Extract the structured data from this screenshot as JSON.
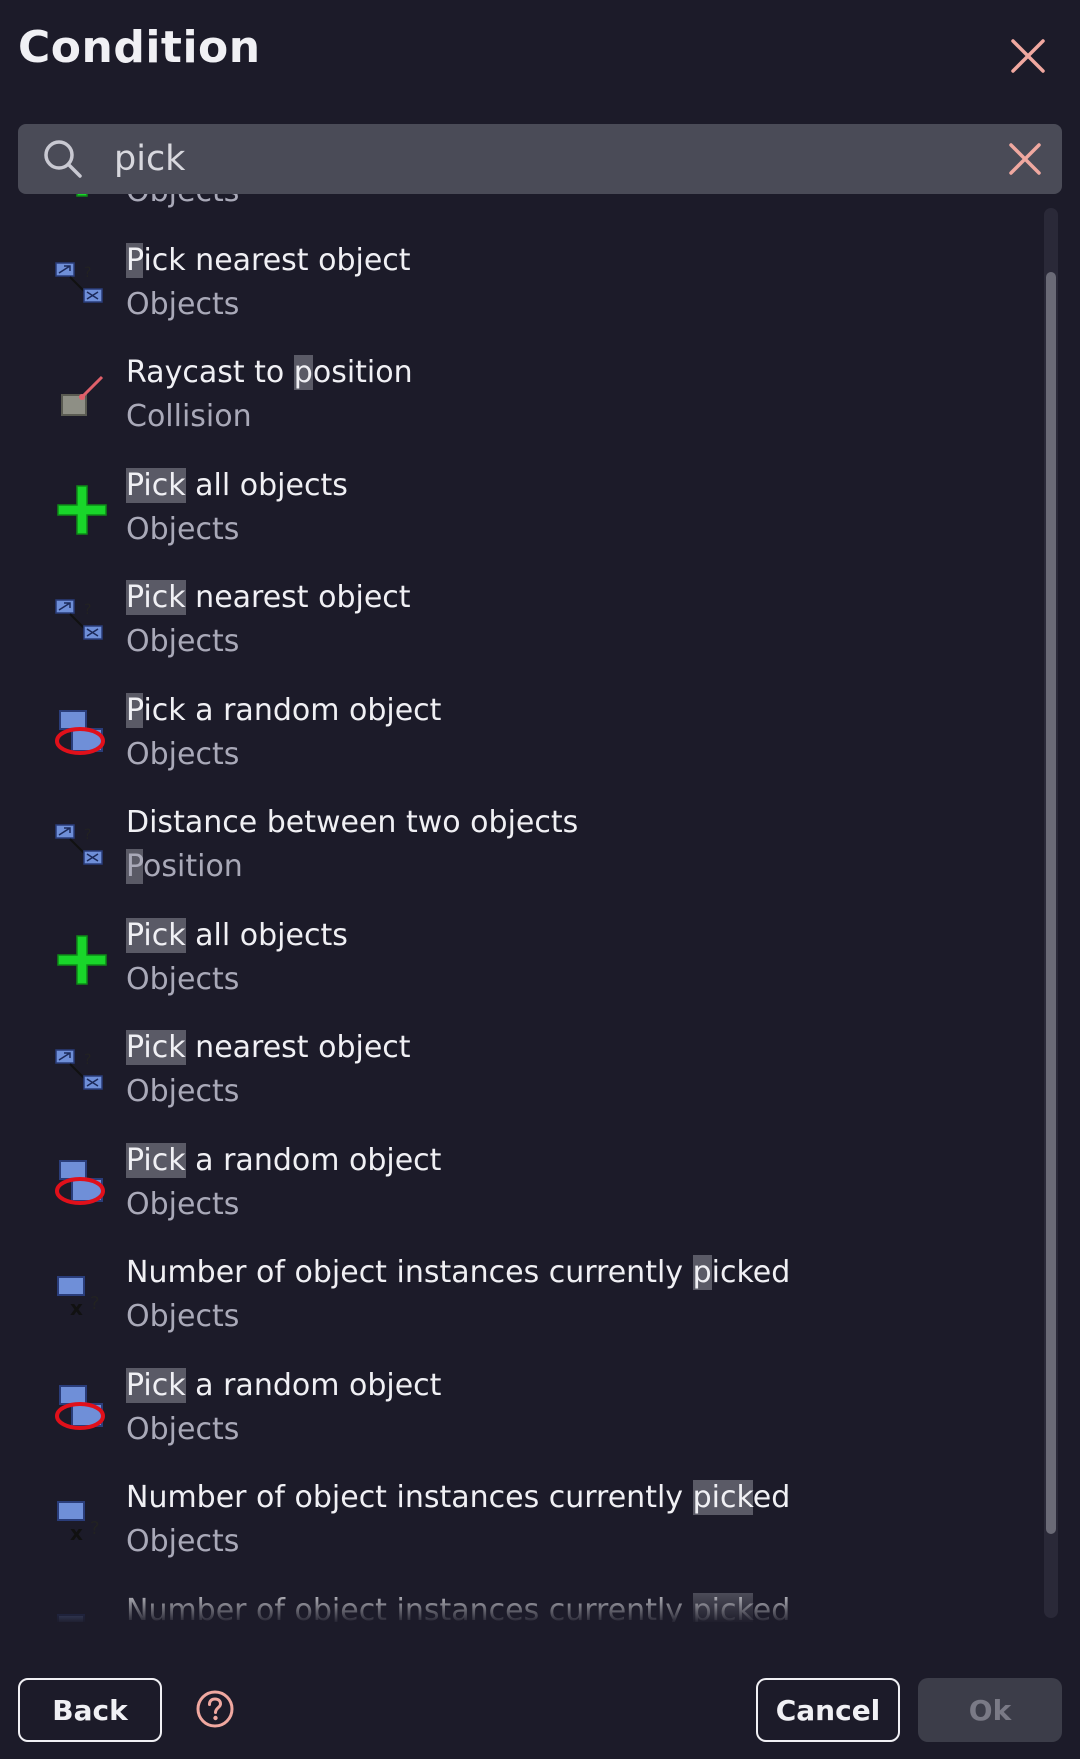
{
  "dialog": {
    "title": "Condition",
    "close_icon": "close-icon"
  },
  "search": {
    "value": "pick",
    "search_icon": "search-icon",
    "clear_icon": "clear-icon"
  },
  "items": [
    {
      "title_pre": "",
      "title_hl": "",
      "title_post": "",
      "sub_pre": "Objects",
      "sub_hl": "",
      "sub_post": "",
      "icon": "green-plus-icon"
    },
    {
      "title_pre": "",
      "title_hl": "P",
      "title_post": "ick nearest object",
      "sub_pre": "Objects",
      "sub_hl": "",
      "sub_post": "",
      "icon": "nearest-object-icon"
    },
    {
      "title_pre": "Raycast to ",
      "title_hl": "p",
      "title_post": "osition",
      "sub_pre": "Collision",
      "sub_hl": "",
      "sub_post": "",
      "icon": "raycast-icon"
    },
    {
      "title_pre": "",
      "title_hl": "Pick",
      "title_post": " all objects",
      "sub_pre": "Objects",
      "sub_hl": "",
      "sub_post": "",
      "icon": "green-plus-icon"
    },
    {
      "title_pre": "",
      "title_hl": "Pick",
      "title_post": " nearest object",
      "sub_pre": "Objects",
      "sub_hl": "",
      "sub_post": "",
      "icon": "nearest-object-icon"
    },
    {
      "title_pre": "",
      "title_hl": "P",
      "title_post": "ick a random object",
      "sub_pre": "Objects",
      "sub_hl": "",
      "sub_post": "",
      "icon": "random-object-icon"
    },
    {
      "title_pre": "Distance between two objects",
      "title_hl": "",
      "title_post": "",
      "sub_pre": "",
      "sub_hl": "P",
      "sub_post": "osition",
      "icon": "nearest-object-icon"
    },
    {
      "title_pre": "",
      "title_hl": "Pick",
      "title_post": " all objects",
      "sub_pre": "Objects",
      "sub_hl": "",
      "sub_post": "",
      "icon": "green-plus-icon"
    },
    {
      "title_pre": "",
      "title_hl": "Pick",
      "title_post": " nearest object",
      "sub_pre": "Objects",
      "sub_hl": "",
      "sub_post": "",
      "icon": "nearest-object-icon"
    },
    {
      "title_pre": "",
      "title_hl": "Pick",
      "title_post": " a random object",
      "sub_pre": "Objects",
      "sub_hl": "",
      "sub_post": "",
      "icon": "random-object-icon"
    },
    {
      "title_pre": "Number of object instances currently ",
      "title_hl": "p",
      "title_post": "icked",
      "sub_pre": "Objects",
      "sub_hl": "",
      "sub_post": "",
      "icon": "instance-count-icon"
    },
    {
      "title_pre": "",
      "title_hl": "Pick",
      "title_post": " a random object",
      "sub_pre": "Objects",
      "sub_hl": "",
      "sub_post": "",
      "icon": "random-object-icon"
    },
    {
      "title_pre": "Number of object instances currently ",
      "title_hl": "pick",
      "title_post": "ed",
      "sub_pre": "Objects",
      "sub_hl": "",
      "sub_post": "",
      "icon": "instance-count-icon"
    },
    {
      "title_pre": "Number of object instances currently ",
      "title_hl": "pick",
      "title_post": "ed",
      "sub_pre": "",
      "sub_hl": "",
      "sub_post": "",
      "icon": "instance-count-icon"
    }
  ],
  "footer": {
    "back_label": "Back",
    "help_icon": "help-icon",
    "cancel_label": "Cancel",
    "ok_label": "Ok"
  },
  "colors": {
    "background": "#1c1b29",
    "close_accent": "#f0a8a0",
    "highlight": "#5a5a66",
    "ok_disabled_bg": "#3c3d49"
  }
}
